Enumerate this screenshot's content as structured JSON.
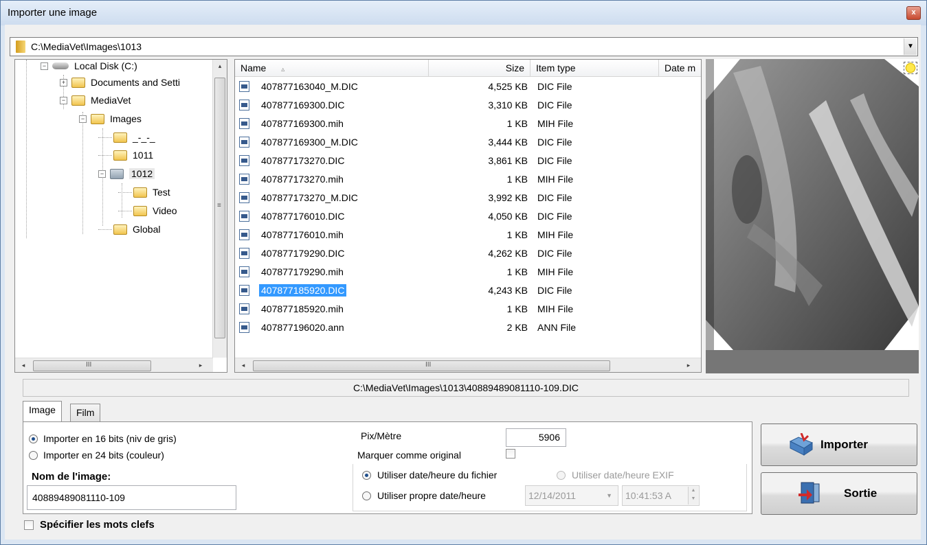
{
  "window": {
    "title": "Importer une image",
    "close_glyph": "x"
  },
  "path_bar": {
    "value": "C:\\MediaVet\\Images\\1013",
    "arrow": "▼"
  },
  "tree": {
    "nodes": [
      {
        "label": "Local Disk (C:)",
        "expander": "−",
        "icon": "disk-icon"
      },
      {
        "label": "Documents and Setti",
        "expander": "+",
        "icon": "folder-icon"
      },
      {
        "label": "MediaVet",
        "expander": "−",
        "icon": "folder-icon"
      },
      {
        "label": "Images",
        "expander": "−",
        "icon": "folder-icon"
      },
      {
        "label": "_-_-_",
        "expander": "",
        "icon": "folder-icon"
      },
      {
        "label": "1011",
        "expander": "",
        "icon": "folder-icon"
      },
      {
        "label": "1012",
        "expander": "−",
        "icon": "folder-icon"
      },
      {
        "label": "Test",
        "expander": "",
        "icon": "folder-icon"
      },
      {
        "label": "Video",
        "expander": "",
        "icon": "folder-icon"
      },
      {
        "label": "Global",
        "expander": "",
        "icon": "folder-icon"
      }
    ],
    "scroll_left": "◂",
    "scroll_right": "▸",
    "scroll_up": "▴",
    "thumb_grip": "III",
    "vthumb_grip": "≡"
  },
  "file_list": {
    "columns": {
      "name": "Name",
      "size": "Size",
      "item_type": "Item type",
      "date": "Date m",
      "sort_glyph": "▵"
    },
    "rows": [
      {
        "name": "407877163040_M.DIC",
        "size": "4,525 KB",
        "type": "DIC File"
      },
      {
        "name": "407877169300.DIC",
        "size": "3,310 KB",
        "type": "DIC File"
      },
      {
        "name": "407877169300.mih",
        "size": "1 KB",
        "type": "MIH File"
      },
      {
        "name": "407877169300_M.DIC",
        "size": "3,444 KB",
        "type": "DIC File"
      },
      {
        "name": "407877173270.DIC",
        "size": "3,861 KB",
        "type": "DIC File"
      },
      {
        "name": "407877173270.mih",
        "size": "1 KB",
        "type": "MIH File"
      },
      {
        "name": "407877173270_M.DIC",
        "size": "3,992 KB",
        "type": "DIC File"
      },
      {
        "name": "407877176010.DIC",
        "size": "4,050 KB",
        "type": "DIC File"
      },
      {
        "name": "407877176010.mih",
        "size": "1 KB",
        "type": "MIH File"
      },
      {
        "name": "407877179290.DIC",
        "size": "4,262 KB",
        "type": "DIC File"
      },
      {
        "name": "407877179290.mih",
        "size": "1 KB",
        "type": "MIH File"
      },
      {
        "name": "407877185920.DIC",
        "size": "4,243 KB",
        "type": "DIC File",
        "selected": true
      },
      {
        "name": "407877185920.mih",
        "size": "1 KB",
        "type": "MIH File"
      },
      {
        "name": "407877196020.ann",
        "size": "2 KB",
        "type": "ANN File"
      }
    ],
    "scroll_left": "◂",
    "scroll_right": "▸",
    "thumb_grip": "III"
  },
  "full_path": "C:\\MediaVet\\Images\\1013\\40889489081110-109.DIC",
  "tabs": {
    "image": "Image",
    "film": "Film"
  },
  "options": {
    "import16": "Importer en 16 bits (niv de gris)",
    "import24": "Importer en 24 bits (couleur)",
    "image_name_label": "Nom de l'image:",
    "image_name_value": "40889489081110-109",
    "pix_label": "Pix/Mètre",
    "pix_value": "5906",
    "mark_original": "Marquer comme original",
    "use_file_date": "Utiliser date/heure du fichier",
    "use_exif_date": "Utiliser date/heure EXIF",
    "use_own_date": "Utiliser propre date/heure",
    "date_value": "12/14/2011",
    "time_value": "10:41:53 A",
    "spin_up": "▲",
    "spin_down": "▼",
    "date_arrow": "▼",
    "keywords": "Spécifier les mots clefs"
  },
  "buttons": {
    "import": "Importer",
    "exit": "Sortie"
  },
  "colors": {
    "selection": "#3399ff",
    "title_bg": "#dbe6f3"
  }
}
